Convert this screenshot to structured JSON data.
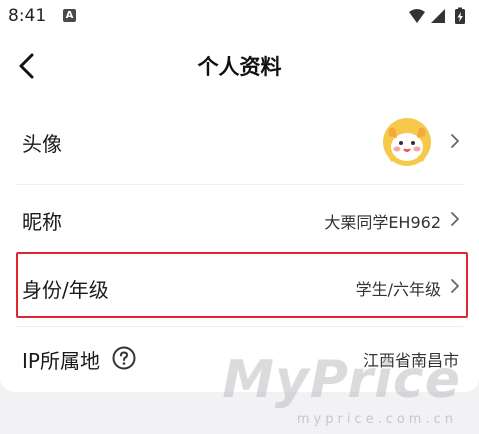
{
  "status_bar": {
    "time": "8:41",
    "a_icon": "A"
  },
  "header": {
    "back_icon": "chevron-left-icon",
    "title": "个人资料"
  },
  "rows": [
    {
      "label": "头像",
      "value": "",
      "icon": "avatar-image"
    },
    {
      "label": "昵称",
      "value": "大栗同学EH962"
    },
    {
      "label": "身份/年级",
      "value": "学生/六年级"
    },
    {
      "label": "IP所属地",
      "value": "江西省南昌市",
      "help_icon": "question-circle-icon"
    }
  ],
  "watermark": {
    "text": "MyPrice",
    "sub": "myprice.com.cn"
  },
  "colors": {
    "highlight_border": "#e0262e",
    "background": "#f2f2f4",
    "card": "#ffffff"
  }
}
